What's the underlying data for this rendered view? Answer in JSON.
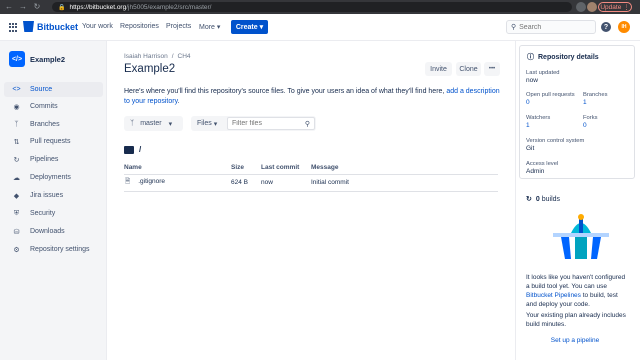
{
  "browser": {
    "url_host": "https://bitbucket.org",
    "url_path": "/jh5005/example2/src/master/",
    "update_label": "Update"
  },
  "topnav": {
    "logo_text": "Bitbucket",
    "links": [
      "Your work",
      "Repositories",
      "Projects",
      "More"
    ],
    "create_label": "Create",
    "search_placeholder": "Search",
    "help_glyph": "?",
    "avatar_initials": "IH"
  },
  "sidebar": {
    "repo_name": "Example2",
    "items": [
      {
        "label": "Source",
        "icon": "code-icon"
      },
      {
        "label": "Commits",
        "icon": "commit-icon"
      },
      {
        "label": "Branches",
        "icon": "branch-icon"
      },
      {
        "label": "Pull requests",
        "icon": "pull-request-icon"
      },
      {
        "label": "Pipelines",
        "icon": "pipelines-icon"
      },
      {
        "label": "Deployments",
        "icon": "deployments-icon"
      },
      {
        "label": "Jira issues",
        "icon": "jira-icon"
      },
      {
        "label": "Security",
        "icon": "shield-icon"
      },
      {
        "label": "Downloads",
        "icon": "download-icon"
      },
      {
        "label": "Repository settings",
        "icon": "gear-icon"
      }
    ]
  },
  "main": {
    "breadcrumb_owner": "Isaiah Harrison",
    "breadcrumb_sep": "/",
    "breadcrumb_project": "CH4",
    "title": "Example2",
    "invite_label": "Invite",
    "clone_label": "Clone",
    "more_glyph": "•••",
    "intro_text": "Here's where you'll find this repository's source files. To give your users an idea of what they'll find here, ",
    "intro_link": "add a description to your repository",
    "intro_end": ".",
    "branch_label": "master",
    "files_dropdown": "Files",
    "files_filter_placeholder": "Filter files",
    "path": "/",
    "table": {
      "headers": [
        "Name",
        "Size",
        "Last commit",
        "Message"
      ],
      "rows": [
        {
          "name": ".gitignore",
          "size": "624 B",
          "last_commit": "now",
          "message": "Initial commit"
        }
      ]
    }
  },
  "details": {
    "title": "Repository details",
    "last_updated_label": "Last updated",
    "last_updated_value": "now",
    "open_prs_label": "Open pull requests",
    "open_prs_value": "0",
    "branches_label": "Branches",
    "branches_value": "1",
    "watchers_label": "Watchers",
    "watchers_value": "1",
    "forks_label": "Forks",
    "forks_value": "0",
    "vcs_label": "Version control system",
    "vcs_value": "Git",
    "access_label": "Access level",
    "access_value": "Admin"
  },
  "builds": {
    "count": "0",
    "label": "builds",
    "text1": "It looks like you haven't configured a build tool yet. You can use ",
    "text1_link": "Bitbucket Pipelines",
    "text1_end": " to build, test and deploy your code.",
    "text2": "Your existing plan already includes build minutes.",
    "setup_link": "Set up a pipeline"
  },
  "colors": {
    "brand": "#0052cc",
    "text": "#172b4d",
    "subtle": "#42526e",
    "update_accent": "#f28b82"
  }
}
